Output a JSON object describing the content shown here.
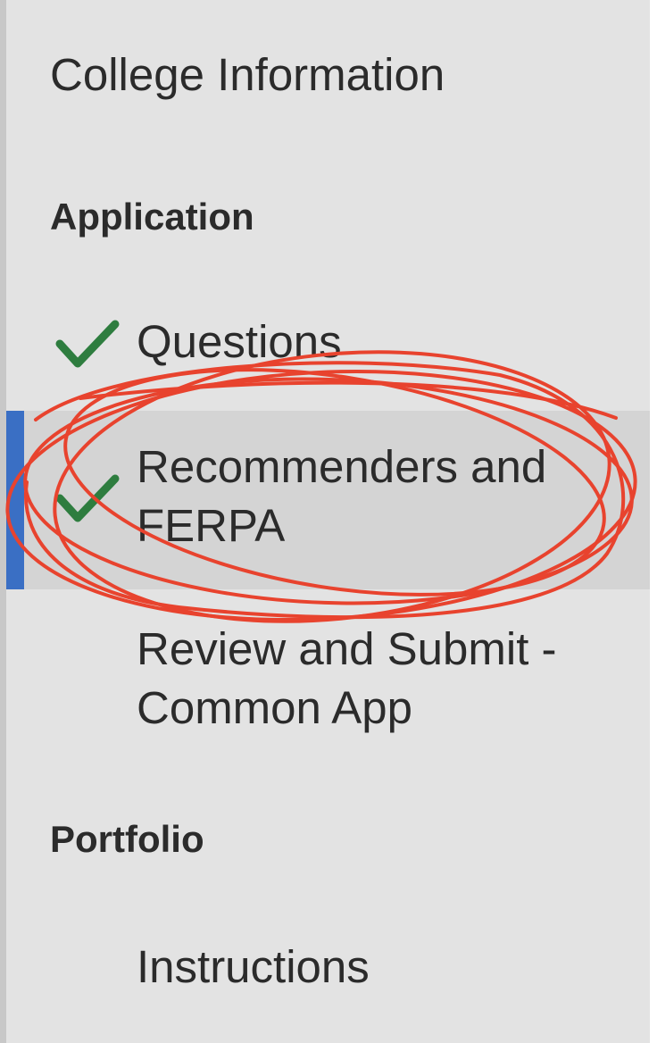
{
  "sidebar": {
    "college_info": "College Information",
    "application_heading": "Application",
    "items": [
      {
        "label": "Questions",
        "completed": true
      },
      {
        "label": "Recommenders and\nFERPA",
        "completed": true,
        "active": true
      },
      {
        "label": "Review and Submit -\nCommon App",
        "completed": false
      }
    ],
    "portfolio_heading": "Portfolio",
    "portfolio_items": [
      {
        "label": "Instructions"
      }
    ]
  },
  "colors": {
    "sidebar_bg": "#e3e3e3",
    "active_bg": "#d4d4d4",
    "active_bar": "#3a6fc4",
    "check": "#2e7d3f",
    "annotation": "#e8432e"
  },
  "icons": {
    "completed": "checkmark-icon"
  }
}
